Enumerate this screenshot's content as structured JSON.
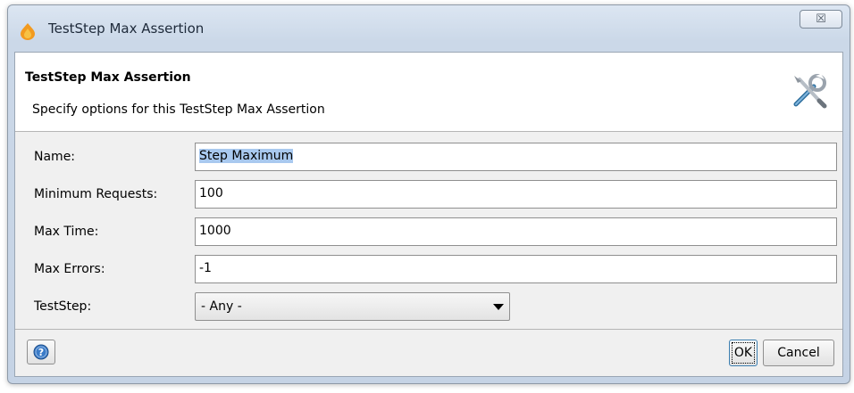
{
  "window": {
    "title": "TestStep Max Assertion",
    "close_glyph": "☒",
    "app_icon": "soapui-flame-icon"
  },
  "header": {
    "title": "TestStep Max Assertion",
    "description": "Specify options for this TestStep Max Assertion",
    "icon": "tools-icon"
  },
  "form": {
    "name_label": "Name:",
    "name_value": "Step Maximum",
    "min_requests_label": "Minimum Requests:",
    "min_requests_value": "100",
    "max_time_label": "Max Time:",
    "max_time_value": "1000",
    "max_errors_label": "Max Errors:",
    "max_errors_value": "-1",
    "teststep_label": "TestStep:",
    "teststep_value": "- Any -"
  },
  "footer": {
    "help_icon": "help-icon",
    "ok_label": "OK",
    "cancel_label": "Cancel"
  },
  "colors": {
    "selection": "#a9c9ef",
    "frame": "#c5d3e5"
  }
}
